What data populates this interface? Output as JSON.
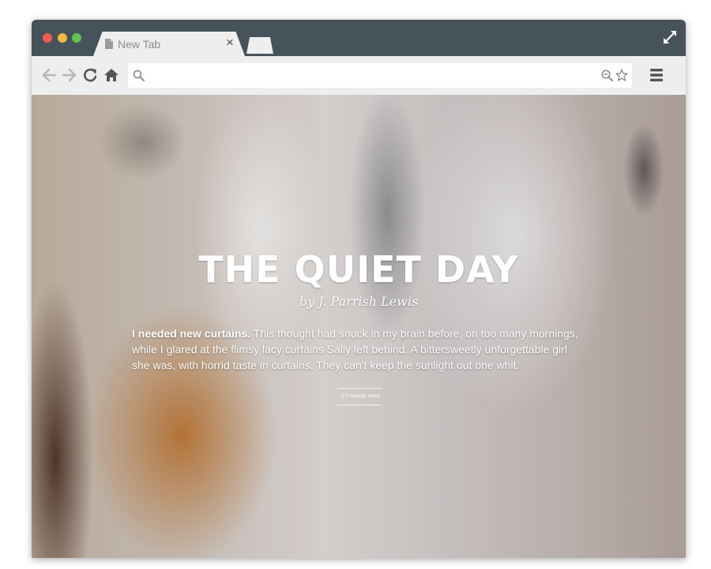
{
  "browser": {
    "tab": {
      "title": "New Tab",
      "close_glyph": "×"
    },
    "icons": {
      "window_controls": [
        "close-dot",
        "minimize-dot",
        "zoom-dot"
      ],
      "tab": "document-icon",
      "fullscreen": "expand-arrows-icon",
      "nav": [
        "back-arrow-icon",
        "forward-arrow-icon",
        "reload-icon",
        "home-icon"
      ],
      "omnibox": [
        "search-icon",
        "zoom-out-icon",
        "star-icon"
      ],
      "menu": "hamburger-menu-icon"
    },
    "address_bar": {
      "value": "",
      "placeholder": ""
    },
    "colors": {
      "titlebar": "#46535a",
      "toolbar": "#eeeeee",
      "close_dot": "#f15b4f",
      "minimize_dot": "#f6b73a",
      "zoom_dot": "#5fc453"
    }
  },
  "article": {
    "title": "THE QUIET DAY",
    "byline": "by J. Parrish Lewis",
    "intro_lead": "I needed new curtains.",
    "intro_text": " This thought had snuck in my brain before, on too many mornings, while I glared at the flimsy lacy curtains Sally left behind. A bittersweetly unforgettable girl she was, with horrid taste in curtains. They can't keep the sunlight out one whit.",
    "read_time": "3-7 minute read"
  }
}
